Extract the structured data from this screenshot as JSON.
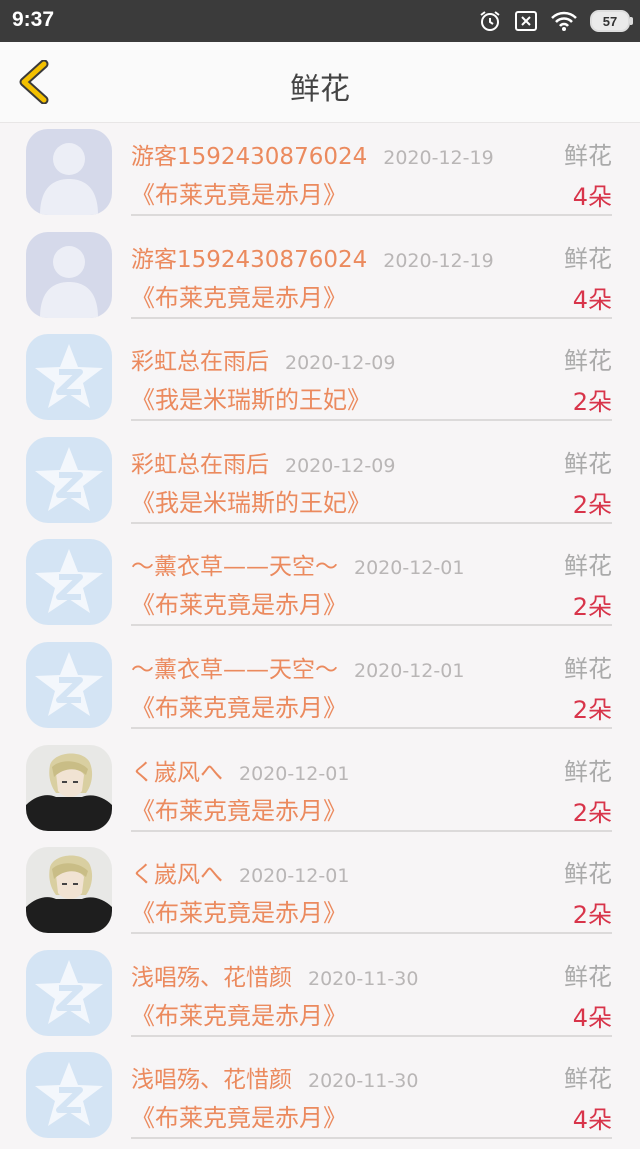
{
  "status": {
    "time": "9:37",
    "battery": "57"
  },
  "header": {
    "title": "鲜花"
  },
  "colors": {
    "accent": "#eb8a5e",
    "count": "#d8344a",
    "muted": "#aaaaaa"
  },
  "items": [
    {
      "name": "游客1592430876024",
      "date": "2020-12-19",
      "type": "鲜花",
      "book": "《布莱克竟是赤月》",
      "count": "4朵",
      "avatar": "default-person"
    },
    {
      "name": "游客1592430876024",
      "date": "2020-12-19",
      "type": "鲜花",
      "book": "《布莱克竟是赤月》",
      "count": "4朵",
      "avatar": "default-person"
    },
    {
      "name": "彩虹总在雨后",
      "date": "2020-12-09",
      "type": "鲜花",
      "book": "《我是米瑞斯的王妃》",
      "count": "2朵",
      "avatar": "qq-star"
    },
    {
      "name": "彩虹总在雨后",
      "date": "2020-12-09",
      "type": "鲜花",
      "book": "《我是米瑞斯的王妃》",
      "count": "2朵",
      "avatar": "qq-star"
    },
    {
      "name": "～薰衣草——天空～",
      "date": "2020-12-01",
      "type": "鲜花",
      "book": "《布莱克竟是赤月》",
      "count": "2朵",
      "avatar": "qq-star"
    },
    {
      "name": "～薰衣草——天空～",
      "date": "2020-12-01",
      "type": "鲜花",
      "book": "《布莱克竟是赤月》",
      "count": "2朵",
      "avatar": "qq-star"
    },
    {
      "name": "く嵗风へ",
      "date": "2020-12-01",
      "type": "鲜花",
      "book": "《布莱克竟是赤月》",
      "count": "2朵",
      "avatar": "anime-photo"
    },
    {
      "name": "く嵗风へ",
      "date": "2020-12-01",
      "type": "鲜花",
      "book": "《布莱克竟是赤月》",
      "count": "2朵",
      "avatar": "anime-photo"
    },
    {
      "name": "浅唱殇、花惜颜",
      "date": "2020-11-30",
      "type": "鲜花",
      "book": "《布莱克竟是赤月》",
      "count": "4朵",
      "avatar": "qq-star"
    },
    {
      "name": "浅唱殇、花惜颜",
      "date": "2020-11-30",
      "type": "鲜花",
      "book": "《布莱克竟是赤月》",
      "count": "4朵",
      "avatar": "qq-star"
    }
  ]
}
